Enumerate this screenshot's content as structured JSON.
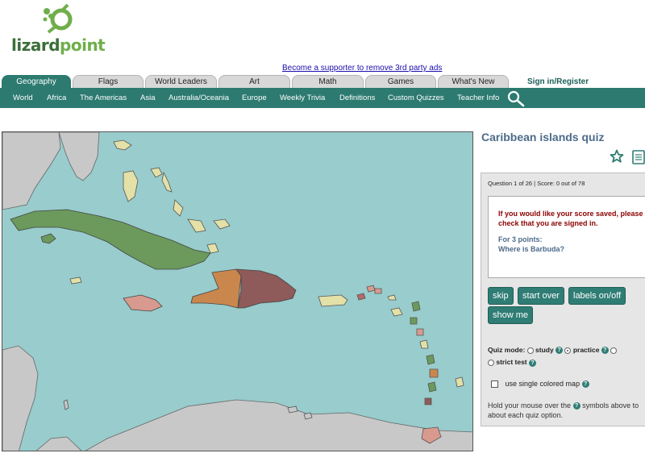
{
  "logo": {
    "text_main": "lizard",
    "text_accent": "point"
  },
  "promo": {
    "text": "Become a supporter to remove 3rd party ads"
  },
  "tabs": [
    {
      "label": "Geography"
    },
    {
      "label": "Flags"
    },
    {
      "label": "World Leaders"
    },
    {
      "label": "Art"
    },
    {
      "label": "Math"
    },
    {
      "label": "Games"
    },
    {
      "label": "What's New"
    }
  ],
  "signin": {
    "label": "Sign in/Register"
  },
  "nav": [
    {
      "label": "World"
    },
    {
      "label": "Africa"
    },
    {
      "label": "The Americas"
    },
    {
      "label": "Asia"
    },
    {
      "label": "Australia/Oceania"
    },
    {
      "label": "Europe"
    },
    {
      "label": "Weekly Trivia"
    },
    {
      "label": "Definitions"
    },
    {
      "label": "Custom Quizzes"
    },
    {
      "label": "Teacher Info"
    }
  ],
  "quiz": {
    "title": "Caribbean islands quiz",
    "score": "Question 1 of 26 | Score: 0 out of 78",
    "signin_note": "If you would like your score saved, please check that you are signed in.",
    "points_label": "For 3 points:",
    "question": "Where is Barbuda?",
    "buttons": {
      "skip": "skip",
      "start_over": "start over",
      "labels": "labels on/off",
      "show_me": "show me"
    },
    "mode_label": "Quiz mode:",
    "modes": {
      "study": "study",
      "practice": "practice",
      "strict": "strict test"
    },
    "single_color": "use single colored map",
    "hold_text_1": "Hold your mouse over the",
    "hold_text_2": "symbols above to",
    "hold_text_3": "about each quiz option."
  },
  "colors": {
    "teal": "#2c7a70",
    "ocean": "#99cccc",
    "land_gray": "#c8c8c8",
    "cuba": "#6b9a5c",
    "haiti": "#c9874e",
    "dominican": "#8e5a5a",
    "jamaica": "#d89a8f",
    "puerto_rico": "#e3e0a8"
  }
}
